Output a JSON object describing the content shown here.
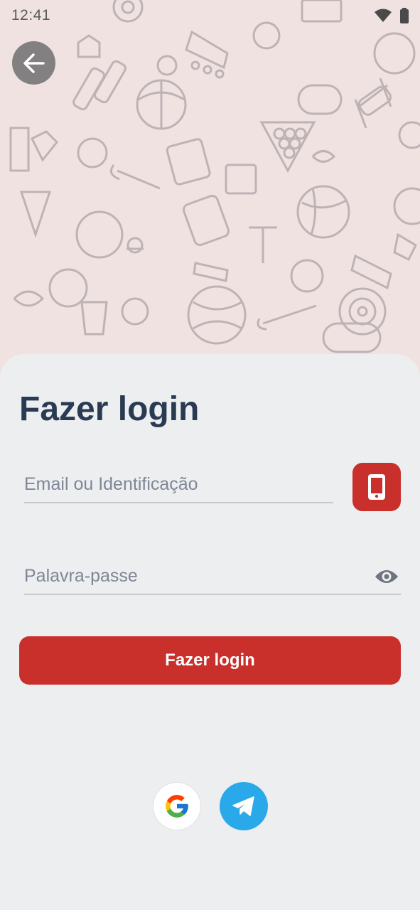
{
  "status_bar": {
    "time": "12:41"
  },
  "header": {
    "back_icon": "arrow-left-icon"
  },
  "login": {
    "title": "Fazer login",
    "email_placeholder": "Email ou Identificação",
    "password_placeholder": "Palavra-passe",
    "submit_label": "Fazer login",
    "phone_icon": "phone-icon",
    "visibility_icon": "eye-icon"
  },
  "social": {
    "providers": [
      {
        "name": "Google",
        "icon": "google-icon"
      },
      {
        "name": "Telegram",
        "icon": "telegram-icon"
      }
    ]
  },
  "colors": {
    "accent": "#c9302c",
    "title": "#2a3a52",
    "sheet": "#eceef0",
    "pattern_bg": "#f1e2e2",
    "telegram": "#29a9e9"
  }
}
